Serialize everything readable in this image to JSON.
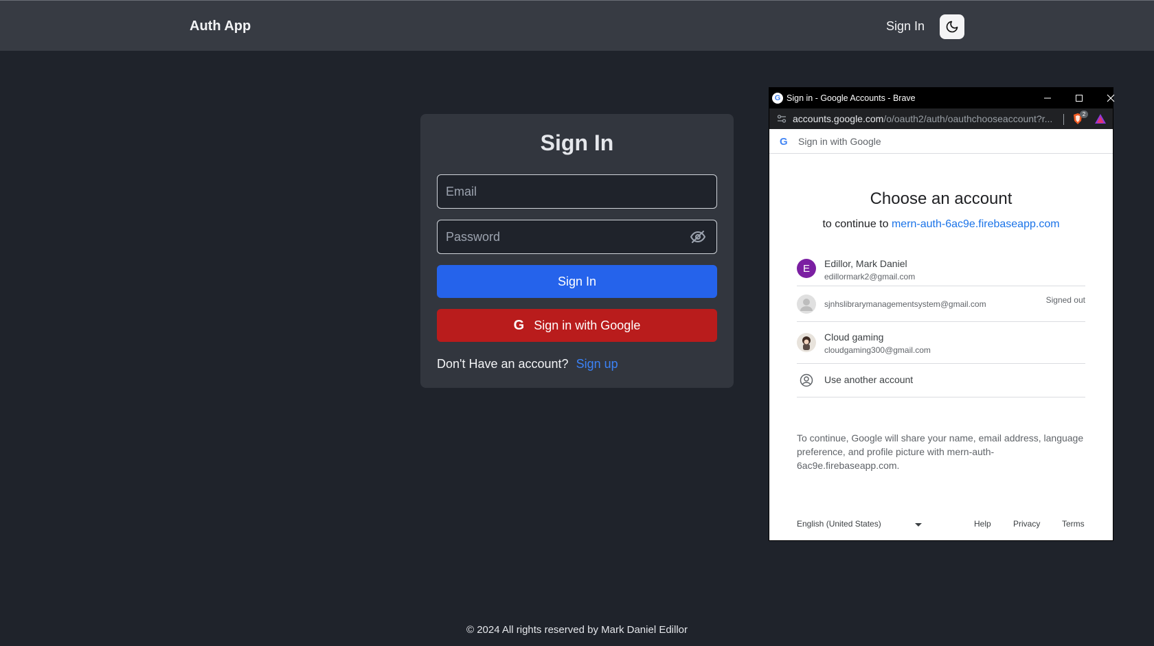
{
  "navbar": {
    "brand": "Auth App",
    "signin_link": "Sign In",
    "theme_icon": "moon-icon"
  },
  "signin_card": {
    "title": "Sign In",
    "email_placeholder": "Email",
    "password_placeholder": "Password",
    "password_toggle_icon": "eye-slash-icon",
    "signin_button": "Sign In",
    "google_button": "Sign in with Google",
    "google_icon": "google-g-icon",
    "no_account_text": "Don't Have an account?",
    "signup_link": "Sign up",
    "colors": {
      "primary": "#2563eb",
      "google": "#b91c1c",
      "link": "#3b82f6"
    }
  },
  "page_footer": "© 2024 All rights reserved by Mark Daniel Edillor",
  "popup": {
    "window_title": "Sign in - Google Accounts - Brave",
    "url_host": "accounts.google.com",
    "url_path": "/o/oauth2/auth/oauthchooseaccount?r...",
    "brave_badge": "2",
    "header_text": "Sign in with Google",
    "choose_title": "Choose an account",
    "continue_prefix": "to continue to",
    "continue_domain": "mern-auth-6ac9e.firebaseapp.com",
    "accounts": [
      {
        "name": "Edillor, Mark Daniel",
        "email": "edillormark2@gmail.com",
        "initial": "E",
        "avatar_color": "#7b1fa2"
      },
      {
        "name": "",
        "email": "sjnhslibrarymanagementsystem@gmail.com",
        "status": "Signed out"
      },
      {
        "name": "Cloud gaming",
        "email": "cloudgaming300@gmail.com"
      }
    ],
    "use_another": "Use another account",
    "consent": "To continue, Google will share your name, email address, language preference, and profile picture with mern-auth-6ac9e.firebaseapp.com.",
    "footer": {
      "language": "English (United States)",
      "help": "Help",
      "privacy": "Privacy",
      "terms": "Terms"
    }
  }
}
